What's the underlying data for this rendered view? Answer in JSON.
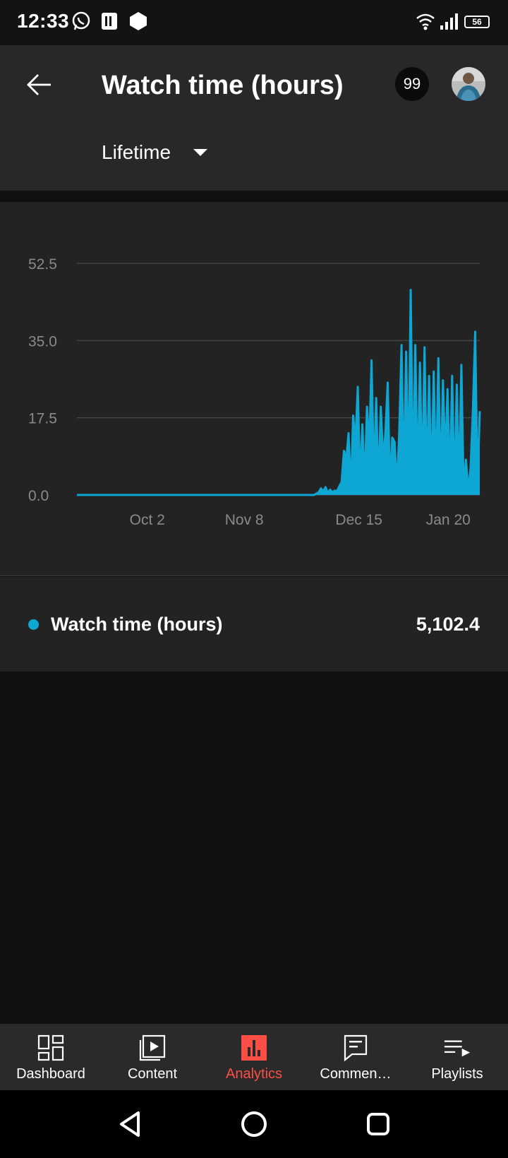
{
  "status_bar": {
    "time": "12:33",
    "icons": [
      "whatsapp-icon",
      "parking-app-icon",
      "hexagon-app-icon",
      "wifi-icon",
      "signal-icon",
      "battery-icon"
    ],
    "battery": "56"
  },
  "header": {
    "title": "Watch time (hours)",
    "notification_count": "99",
    "range_label": "Lifetime"
  },
  "chart_data": {
    "type": "line",
    "series_color": "#0ea7d3",
    "ylim": [
      0,
      52.5
    ],
    "yticks": [
      "52.5",
      "35.0",
      "17.5",
      "0.0"
    ],
    "xticks": [
      "Oct 2",
      "Nov 8",
      "Dec 15",
      "Jan 20"
    ],
    "x_start": "2023-09-15",
    "x_end": "2024-01-23",
    "series": [
      {
        "values": [
          0,
          0,
          0,
          0,
          0,
          0,
          0,
          0,
          0,
          0,
          0,
          0,
          0,
          0,
          0,
          0,
          0,
          0,
          0,
          0,
          0,
          0,
          0,
          0,
          0,
          0,
          0,
          0,
          0,
          0,
          0,
          0,
          0,
          0,
          0,
          0,
          0,
          0,
          0,
          0,
          0,
          0,
          0,
          0,
          0,
          0,
          0,
          0,
          0,
          0,
          0,
          0,
          0,
          0,
          0,
          0,
          0,
          0,
          0,
          0,
          0,
          0,
          0,
          0,
          0,
          0,
          0,
          0,
          0,
          0,
          0,
          0,
          0,
          0,
          0,
          0,
          0,
          0,
          0,
          0,
          0,
          0,
          0,
          0,
          0,
          0,
          0,
          0,
          0,
          0,
          0,
          0,
          0,
          0,
          0,
          0,
          0,
          0,
          0,
          0,
          0,
          0,
          0,
          0,
          0.3,
          0.6,
          1.5,
          0.8,
          1.8,
          0.5,
          1.2,
          0.6,
          1.0,
          0.9,
          2.0,
          3.0,
          10.0,
          8.0,
          14.0,
          1.0,
          18.0,
          12.0,
          24.5,
          3.0,
          16.0,
          2.0,
          20.0,
          11.0,
          30.5,
          4.0,
          22.0,
          1.5,
          20.0,
          8.0,
          14.0,
          25.5,
          2.0,
          13.0,
          12.0,
          1.5,
          14.0,
          34.0,
          2.0,
          32.5,
          3.0,
          46.5,
          1.0,
          34.0,
          2.0,
          30.0,
          1.5,
          33.5,
          2.0,
          27.0,
          1.0,
          28.0,
          2.0,
          31.0,
          1.5,
          26.0,
          8.0,
          24.0,
          2.0,
          27.0,
          0.5,
          25.0,
          1.0,
          29.5,
          0.5,
          8.0,
          1.0,
          6.0,
          19.0,
          37.0,
          2.0,
          19.0
        ]
      }
    ]
  },
  "legend": {
    "label": "Watch time (hours)",
    "value": "5,102.4"
  },
  "bottom_nav": [
    {
      "label": "Dashboard",
      "icon": "dashboard-icon"
    },
    {
      "label": "Content",
      "icon": "content-icon"
    },
    {
      "label": "Analytics",
      "icon": "analytics-icon",
      "active": true
    },
    {
      "label": "Commen…",
      "icon": "comments-icon"
    },
    {
      "label": "Playlists",
      "icon": "playlists-icon"
    }
  ],
  "colors": {
    "accent": "#ff4e45",
    "series": "#0ea7d3",
    "card_bg": "#232323",
    "header_bg": "#282828"
  }
}
